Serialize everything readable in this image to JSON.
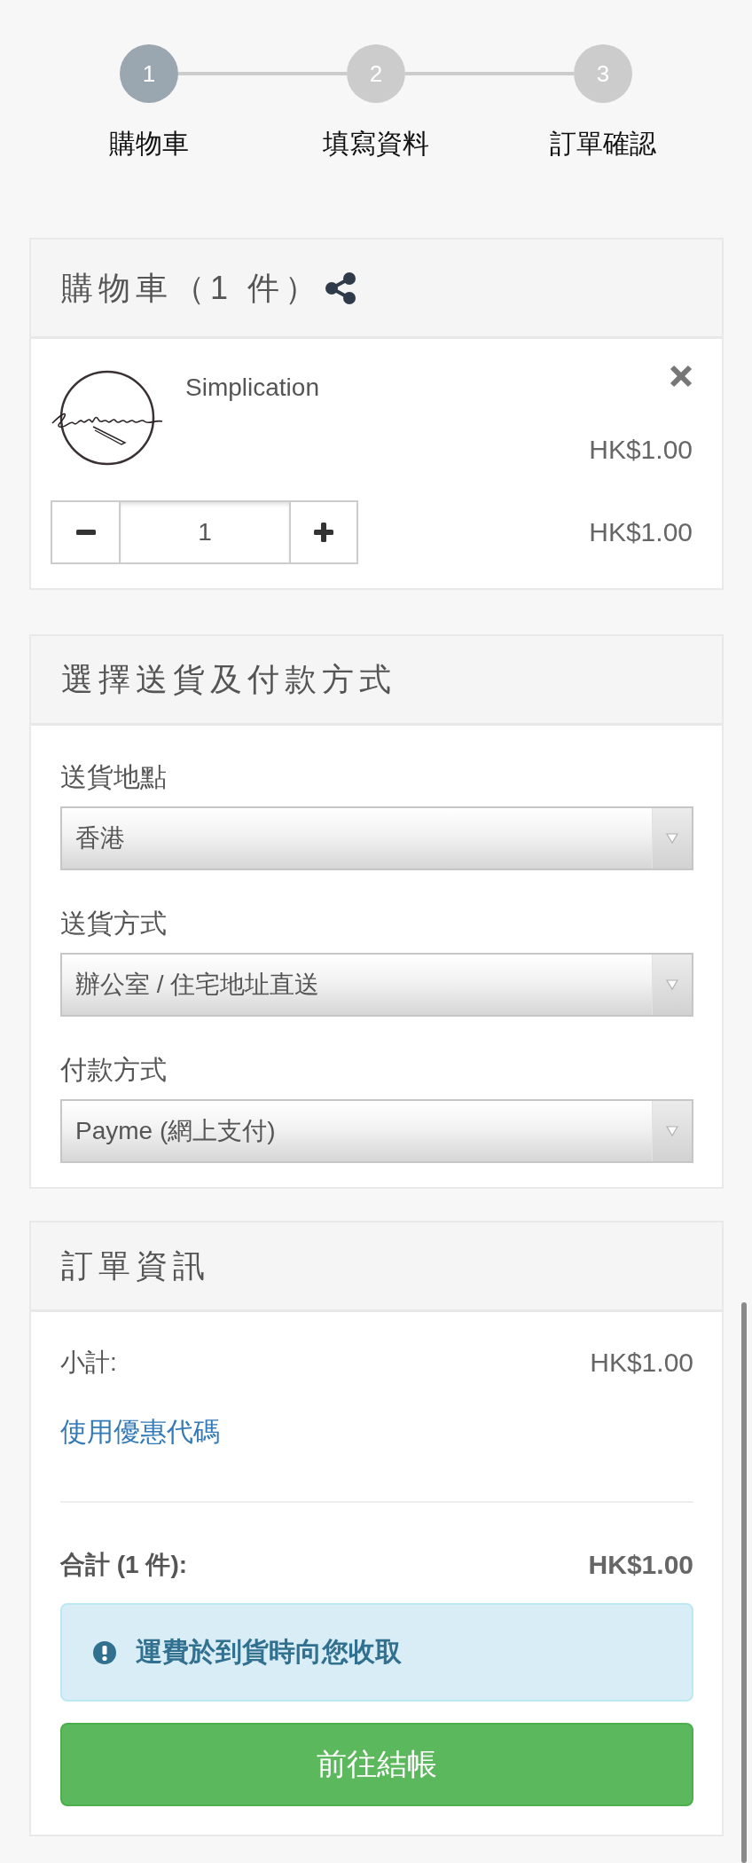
{
  "steps": [
    {
      "number": "1",
      "label": "購物車",
      "selected": true
    },
    {
      "number": "2",
      "label": "填寫資料",
      "selected": false
    },
    {
      "number": "3",
      "label": "訂單確認",
      "selected": false
    }
  ],
  "cart": {
    "title": "購物車（1 件）",
    "items": [
      {
        "name": "Simplication",
        "unit_price": "HK$1.00",
        "quantity": "1",
        "line_total": "HK$1.00"
      }
    ]
  },
  "delivery_payment": {
    "title": "選擇送貨及付款方式",
    "fields": [
      {
        "label": "送貨地點",
        "value": "香港"
      },
      {
        "label": "送貨方式",
        "value": "辦公室 / 住宅地址直送"
      },
      {
        "label": "付款方式",
        "value": "Payme (網上支付)"
      }
    ]
  },
  "order_summary": {
    "title": "訂單資訊",
    "subtotal": {
      "label": "小計:",
      "value": "HK$1.00"
    },
    "coupon_link": "使用優惠代碼",
    "total": {
      "label": "合計 (1 件):",
      "value": "HK$1.00"
    },
    "notice": "運費於到貨時向您收取",
    "checkout_button": "前往結帳"
  }
}
